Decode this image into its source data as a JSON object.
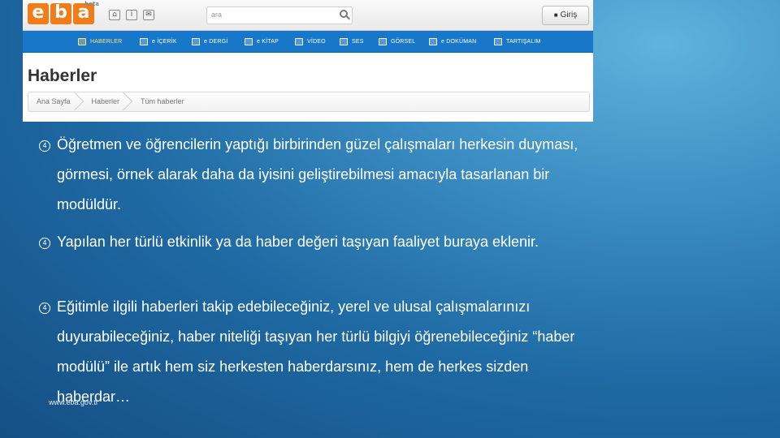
{
  "site": {
    "logo_letters": [
      "e",
      "b",
      "a"
    ],
    "logo_badge": "beta",
    "top_icons": [
      "home-icon",
      "info-icon",
      "mail-icon"
    ],
    "search_placeholder": "ara",
    "login_label": "Giriş",
    "nav": [
      {
        "label": "HABERLER",
        "icon": "news-icon",
        "active": true
      },
      {
        "label": "e İÇERİK",
        "icon": "content-icon",
        "active": false
      },
      {
        "label": "e DERGİ",
        "icon": "magazine-icon",
        "active": false
      },
      {
        "label": "e KİTAP",
        "icon": "book-icon",
        "active": false
      },
      {
        "label": "VİDEO",
        "icon": "video-icon",
        "active": false
      },
      {
        "label": "SES",
        "icon": "audio-icon",
        "active": false
      },
      {
        "label": "GÖRSEL",
        "icon": "image-icon",
        "active": false
      },
      {
        "label": "e DOKÜMAN",
        "icon": "document-icon",
        "active": false
      },
      {
        "label": "TARTIŞALIM",
        "icon": "discussion-icon",
        "active": false
      }
    ],
    "page_title": "Haberler",
    "breadcrumb": [
      "Ana Sayfa",
      "Haberler",
      "Tüm haberler"
    ]
  },
  "slide": {
    "bullets": [
      "Öğretmen ve öğrencilerin yaptığı birbirinden güzel çalışmaları herkesin duyması, görmesi, örnek alarak daha da iyisini geliştirebilmesi amacıyla tasarlanan bir modüldür.",
      "Yapılan her türlü etkinlik ya da haber değeri taşıyan faaliyet buraya eklenir.",
      "Eğitimle ilgili haberleri takip edebileceğiniz, yerel ve ulusal çalışmalarınızı duyurabileceğiniz, haber niteliği taşıyan her türlü bilgiyi öğrenebileceğiniz “haber modülü” ile artık hem siz herkesten haberdarsınız, hem de herkes sizden haberdar…"
    ],
    "bullet_icon": "circled-four-icon",
    "footer_url": "www.eba.gov.tr"
  },
  "colors": {
    "brand_orange": "#f07c1a",
    "nav_blue": "#1877c9",
    "background_blue": "#1f6aa4"
  }
}
